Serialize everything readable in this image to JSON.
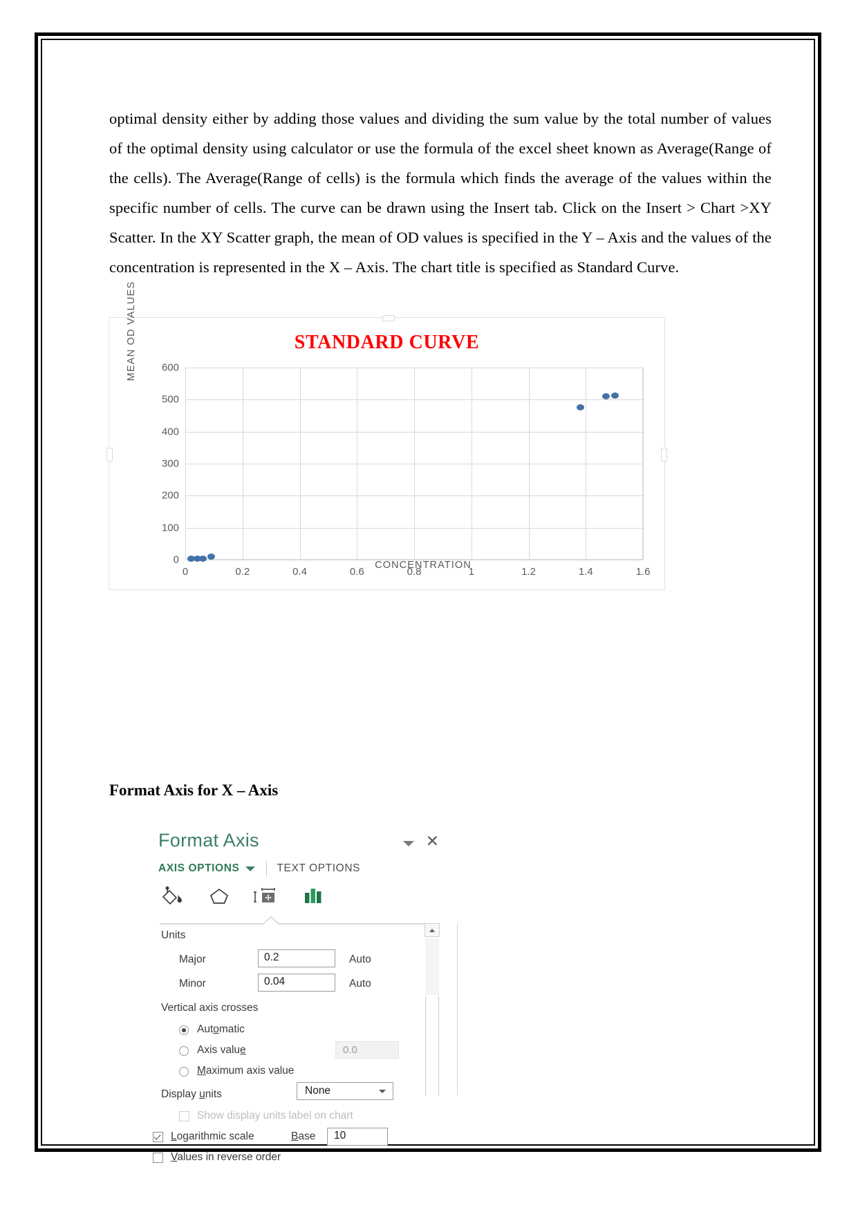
{
  "document": {
    "paragraph": "optimal density either by adding those values and dividing the sum value by the total number of values of the optimal density using calculator or use the formula of the excel sheet known as Average(Range of the cells). The Average(Range of cells) is the formula which finds the average of the values within the specific number of cells. The curve can be drawn using the Insert tab. Click on the Insert > Chart >XY Scatter. In the XY Scatter graph, the mean of OD values is specified in the Y – Axis and the values of the concentration is represented in the X – Axis. The chart title is specified as Standard Curve.",
    "sub_heading": "Format Axis for X – Axis"
  },
  "chart_data": {
    "type": "scatter",
    "title": "STANDARD CURVE",
    "title_color": "#ff0000",
    "xlabel": "CONCENTRATION",
    "ylabel": "MEAN OD VALUES",
    "xlim": [
      0,
      1.6
    ],
    "ylim": [
      0,
      600
    ],
    "x_ticks": [
      "0",
      "0.2",
      "0.4",
      "0.6",
      "0.8",
      "1",
      "1.2",
      "1.4",
      "1.6"
    ],
    "x_tick_values": [
      0,
      0.2,
      0.4,
      0.6,
      0.8,
      1,
      1.2,
      1.4,
      1.6
    ],
    "y_ticks": [
      "0",
      "100",
      "200",
      "300",
      "400",
      "500",
      "600"
    ],
    "y_tick_values": [
      0,
      100,
      200,
      300,
      400,
      500,
      600
    ],
    "grid": true,
    "legend": false,
    "marker_color": "#4472a8",
    "series": [
      {
        "name": "MEAN OD VALUES",
        "points": [
          {
            "x": 0.02,
            "y": 4
          },
          {
            "x": 0.04,
            "y": 4
          },
          {
            "x": 0.06,
            "y": 5
          },
          {
            "x": 0.09,
            "y": 10
          },
          {
            "x": 1.38,
            "y": 477
          },
          {
            "x": 1.47,
            "y": 511
          },
          {
            "x": 1.5,
            "y": 513
          }
        ]
      }
    ]
  },
  "format_axis_panel": {
    "title": "Format Axis",
    "collapse_icon": "chevron-down-icon",
    "close_icon": "close-icon",
    "tabs": {
      "axis_options": "AXIS OPTIONS",
      "text_options": "TEXT OPTIONS"
    },
    "icon_tabs": [
      {
        "name": "fill-line-icon",
        "label": "Fill & Line"
      },
      {
        "name": "effects-pentagon-icon",
        "label": "Effects"
      },
      {
        "name": "size-properties-icon",
        "label": "Size & Properties"
      },
      {
        "name": "axis-options-chart-icon",
        "label": "Axis Options"
      }
    ],
    "sections": {
      "units_label": "Units",
      "major_label": "Major",
      "major_value": "0.2",
      "major_auto": "Auto",
      "minor_label": "Minor",
      "minor_value": "0.04",
      "minor_auto": "Auto",
      "vertical_axis_crosses_label": "Vertical axis crosses",
      "automatic_label": "Automatic",
      "automatic_checked": true,
      "axis_value_label": "Axis value",
      "axis_value_checked": false,
      "axis_value_field": "0.0",
      "maximum_axis_value_label": "Maximum axis value",
      "maximum_axis_value_checked": false,
      "display_units_label": "Display units",
      "display_units_value": "None",
      "show_display_units_label": "Show display units label on chart",
      "show_display_units_checked": false,
      "show_display_units_disabled": true,
      "logarithmic_scale_label": "Logarithmic scale",
      "logarithmic_scale_checked": true,
      "base_label": "Base",
      "base_value": "10",
      "values_reverse_label": "Values in reverse order",
      "values_reverse_checked": false
    }
  }
}
